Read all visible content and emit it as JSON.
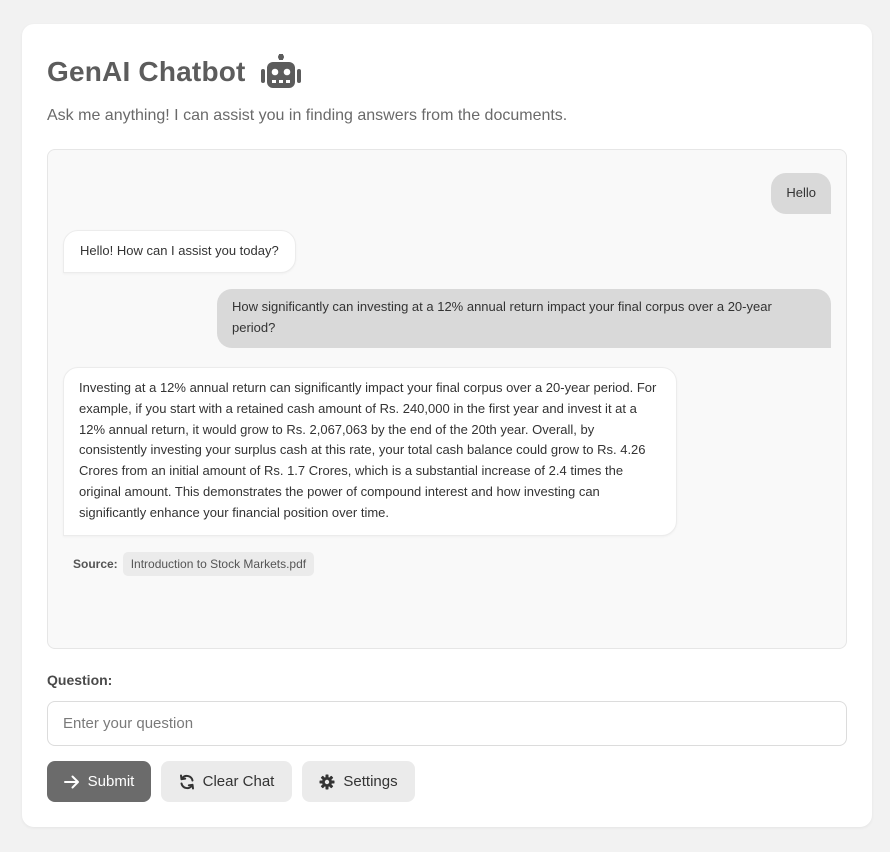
{
  "header": {
    "title": "GenAI Chatbot",
    "icon": "robot-icon",
    "subtitle": "Ask me anything! I can assist you in finding answers from the documents."
  },
  "chat": {
    "messages": [
      {
        "role": "user",
        "text": "Hello"
      },
      {
        "role": "bot",
        "text": "Hello! How can I assist you today?"
      },
      {
        "role": "user",
        "text": "How significantly can investing at a 12% annual return impact your final corpus over a 20-year period?"
      },
      {
        "role": "bot",
        "text": "Investing at a 12% annual return can significantly impact your final corpus over a 20-year period. For example, if you start with a retained cash amount of Rs. 240,000 in the first year and invest it at a 12% annual return, it would grow to Rs. 2,067,063 by the end of the 20th year. Overall, by consistently investing your surplus cash at this rate, your total cash balance could grow to Rs. 4.26 Crores from an initial amount of Rs. 1.7 Crores, which is a substantial increase of 2.4 times the original amount. This demonstrates the power of compound interest and how investing can significantly enhance your financial position over time."
      }
    ],
    "source_label": "Source:",
    "source_file": "Introduction to Stock Markets.pdf"
  },
  "form": {
    "question_label": "Question:",
    "placeholder": "Enter your question",
    "value": ""
  },
  "buttons": {
    "submit": "Submit",
    "clear": "Clear Chat",
    "settings": "Settings"
  },
  "colors": {
    "primary_button": "#6b6b6b",
    "user_bubble": "#d9d9d9",
    "bot_bubble": "#ffffff",
    "chat_background": "#f9f9f9"
  }
}
